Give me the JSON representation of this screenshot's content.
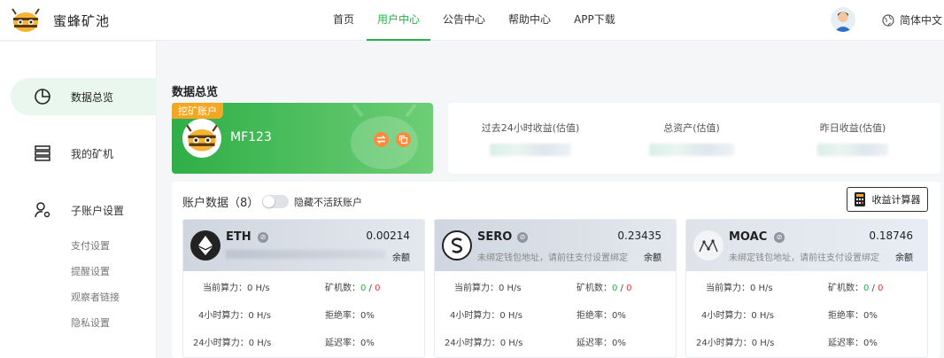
{
  "header": {
    "brand": "蜜蜂矿池",
    "nav": [
      "首页",
      "用户中心",
      "公告中心",
      "帮助中心",
      "APP下载"
    ],
    "active_nav": "用户中心",
    "language": "简体中文"
  },
  "sidebar": {
    "items": [
      "数据总览",
      "我的矿机",
      "子账户设置"
    ],
    "active_item": "数据总览",
    "sub_items": [
      "支付设置",
      "提醒设置",
      "观察者链接",
      "隐私设置"
    ]
  },
  "main": {
    "title": "数据总览",
    "mining_account": {
      "tag": "挖矿账户",
      "name": "MF123"
    },
    "stats": {
      "labels": [
        "过去24小时收益(估值)",
        "总资产(估值)",
        "昨日收益(估值)"
      ]
    },
    "accounts": {
      "title": "账户数据（8）",
      "toggle_label": "隐藏不活跃账户",
      "calc_button": "收益计算器",
      "labels": {
        "balance": "余额",
        "hashrate_now": "当前算力：",
        "hashrate_4h": "4小时算力：",
        "hashrate_24h": "24小时算力：",
        "miners": "矿机数：",
        "reject": "拒绝率：",
        "latency": "延迟率：",
        "unbound": "未绑定钱包地址，请前往支付设置绑定"
      },
      "coins": [
        {
          "name": "ETH",
          "balance": "0.00214",
          "hashrate_now": "0 H/s",
          "hashrate_4h": "0 H/s",
          "hashrate_24h": "0 H/s",
          "miners_active": "0",
          "miners_inactive": "0",
          "reject": "0%",
          "latency": "0%"
        },
        {
          "name": "SERO",
          "balance": "0.23435",
          "hashrate_now": "0 H/s",
          "hashrate_4h": "0 H/s",
          "hashrate_24h": "0 H/s",
          "miners_active": "0",
          "miners_inactive": "0",
          "reject": "0%",
          "latency": "0%"
        },
        {
          "name": "MOAC",
          "balance": "0.18746",
          "hashrate_now": "0 H/s",
          "hashrate_4h": "0 H/s",
          "hashrate_24h": "0 H/s",
          "miners_active": "0",
          "miners_inactive": "0",
          "reject": "0%",
          "latency": "0%"
        }
      ]
    }
  },
  "colors": {
    "accent": "#24b24b",
    "tag": "#f5a623",
    "swap": "#ff8a3d",
    "inactive": "#e33333"
  }
}
